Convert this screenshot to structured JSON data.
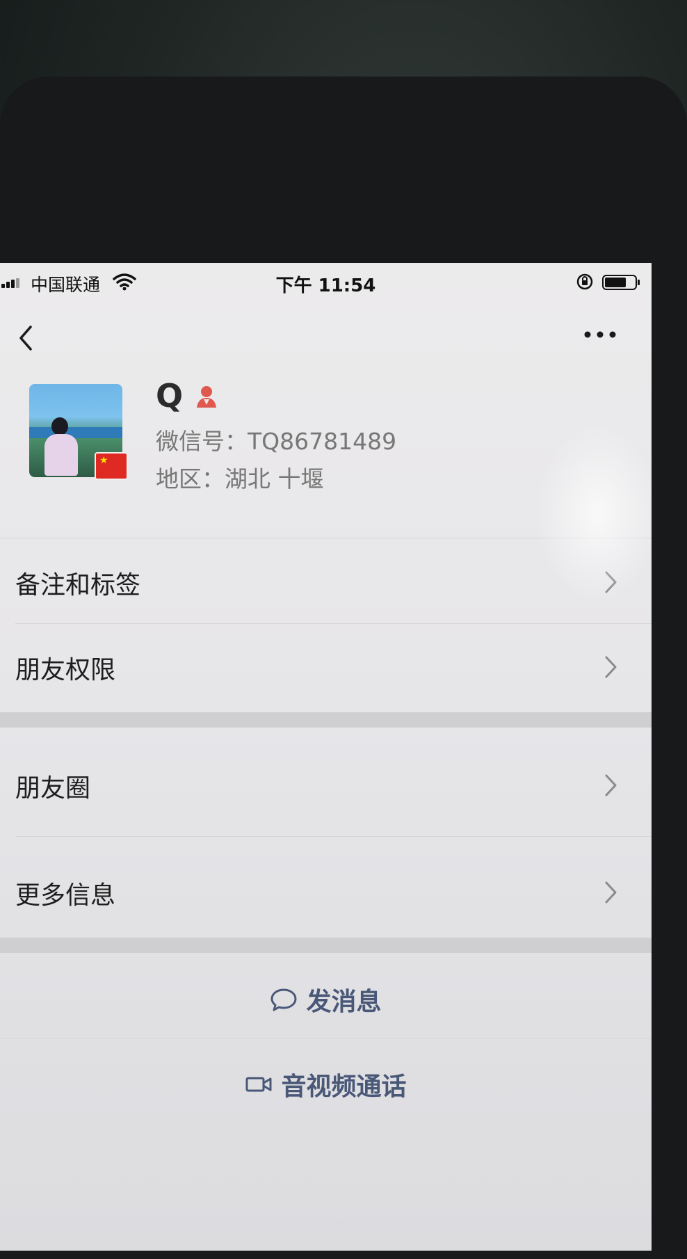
{
  "status_bar": {
    "carrier": "中国联通",
    "time": "下午 11:54"
  },
  "profile": {
    "nickname": "Q",
    "wechat_id": "微信号：TQ86781489",
    "region": "地区：湖北 十堰"
  },
  "menu": {
    "items": [
      {
        "label": "备注和标签"
      },
      {
        "label": "朋友权限"
      },
      {
        "label": "朋友圈"
      },
      {
        "label": "更多信息"
      }
    ]
  },
  "actions": {
    "send_message": "发消息",
    "video_call": "音视频通话"
  },
  "colors": {
    "action_text": "#4a5878",
    "gender_female": "#e0594f",
    "flag_red": "#de2a23"
  },
  "icons": [
    "back-icon",
    "more-icon",
    "female-icon",
    "china-flag-icon",
    "chevron-right-icon",
    "chat-bubble-icon",
    "video-camera-icon",
    "wifi-icon",
    "battery-icon"
  ]
}
